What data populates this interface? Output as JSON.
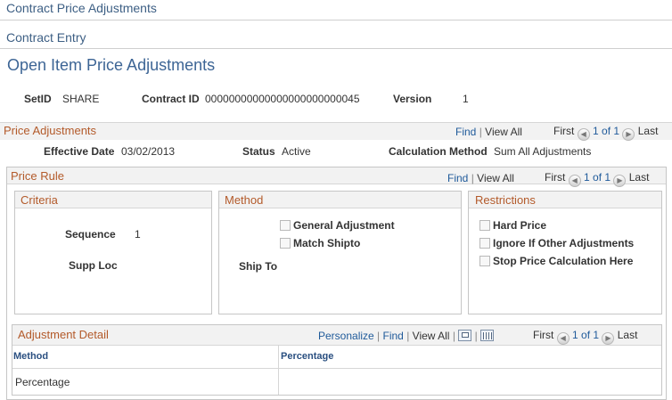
{
  "breadcrumbs": [
    "Contract Price Adjustments",
    "Contract Entry"
  ],
  "page_title": "Open Item Price Adjustments",
  "header_fields": {
    "setid_label": "SetID",
    "setid_value": "SHARE",
    "contract_label": "Contract ID",
    "contract_value": "00000000000000000000000045",
    "version_label": "Version",
    "version_value": "1"
  },
  "price_adjustments": {
    "title": "Price Adjustments",
    "find": "Find",
    "view_all": "View All",
    "first": "First",
    "range": "1 of 1",
    "last": "Last",
    "effective_date_label": "Effective Date",
    "effective_date_value": "03/02/2013",
    "status_label": "Status",
    "status_value": "Active",
    "calc_method_label": "Calculation Method",
    "calc_method_value": "Sum All Adjustments"
  },
  "price_rule": {
    "title": "Price Rule",
    "find": "Find",
    "view_all": "View All",
    "first": "First",
    "range": "1 of 1",
    "last": "Last",
    "criteria": {
      "title": "Criteria",
      "sequence_label": "Sequence",
      "sequence_value": "1",
      "supp_loc_label": "Supp Loc"
    },
    "method": {
      "title": "Method",
      "general_adjustment": "General Adjustment",
      "match_shipto": "Match Shipto",
      "ship_to_label": "Ship To"
    },
    "restrictions": {
      "title": "Restrictions",
      "hard_price": "Hard Price",
      "ignore_other": "Ignore If Other Adjustments",
      "stop_calc": "Stop Price Calculation Here"
    }
  },
  "adjustment_detail": {
    "title": "Adjustment Detail",
    "personalize": "Personalize",
    "find": "Find",
    "view_all": "View All",
    "first": "First",
    "range": "1 of 1",
    "last": "Last",
    "columns": [
      "Method",
      "Percentage"
    ],
    "rows": [
      {
        "method": "Percentage",
        "percentage": ""
      }
    ]
  }
}
